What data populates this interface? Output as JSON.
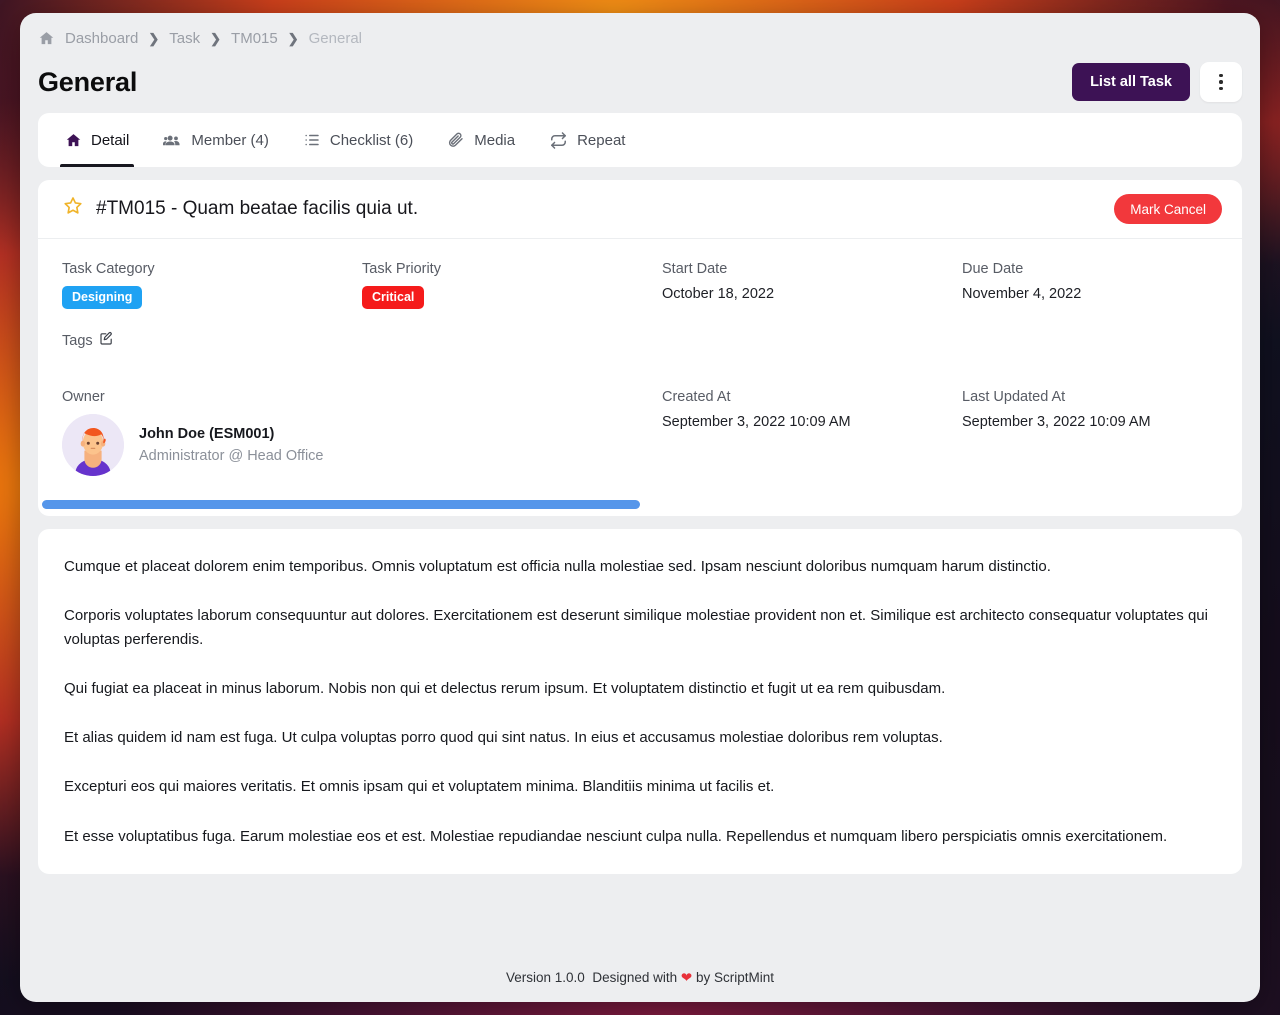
{
  "breadcrumb": {
    "home_icon": "home-icon",
    "items": [
      {
        "label": "Dashboard"
      },
      {
        "label": "Task"
      },
      {
        "label": "TM015"
      },
      {
        "label": "General"
      }
    ],
    "separator": "❯"
  },
  "header": {
    "title": "General",
    "primary_button": "List all Task",
    "kebab_icon": "more-vertical-icon",
    "primary_color": "#3d1255"
  },
  "tabs": [
    {
      "label": "Detail",
      "icon": "home-icon",
      "active": true
    },
    {
      "label": "Member (4)",
      "icon": "users-icon",
      "active": false
    },
    {
      "label": "Checklist (6)",
      "icon": "list-icon",
      "active": false
    },
    {
      "label": "Media",
      "icon": "paperclip-icon",
      "active": false
    },
    {
      "label": "Repeat",
      "icon": "repeat-icon",
      "active": false
    }
  ],
  "task": {
    "star_icon": "star-outline-icon",
    "title": "#TM015 - Quam beatae facilis quia ut.",
    "status_button": "Mark Cancel",
    "status_button_color": "#f2383c",
    "fields": {
      "category_label": "Task Category",
      "category_value": "Designing",
      "category_color": "#1fa2f3",
      "priority_label": "Task Priority",
      "priority_value": "Critical",
      "priority_color": "#f51b1b",
      "start_date_label": "Start Date",
      "start_date_value": "October 18, 2022",
      "due_date_label": "Due Date",
      "due_date_value": "November 4, 2022",
      "tags_label": "Tags",
      "tags_edit_icon": "edit-square-icon",
      "owner_label": "Owner",
      "created_at_label": "Created At",
      "created_at_value": "September 3, 2022 10:09 AM",
      "last_updated_label": "Last Updated At",
      "last_updated_value": "September 3, 2022 10:09 AM"
    },
    "owner": {
      "avatar_icon": "user-avatar",
      "name": "John Doe (ESM001)",
      "subtitle": "Administrator @ Head Office"
    }
  },
  "scrollbar": {
    "name": "horizontal-scrollbar",
    "thumb_percent": 50,
    "color": "#5596ea"
  },
  "description": {
    "paragraphs": [
      "Cumque et placeat dolorem enim temporibus. Omnis voluptatum est officia nulla molestiae sed. Ipsam nesciunt doloribus numquam harum distinctio.",
      "Corporis voluptates laborum consequuntur aut dolores. Exercitationem est deserunt similique molestiae provident non et. Similique est architecto consequatur voluptates qui voluptas perferendis.",
      "Qui fugiat ea placeat in minus laborum. Nobis non qui et delectus rerum ipsum. Et voluptatem distinctio et fugit ut ea rem quibusdam.",
      "Et alias quidem id nam est fuga. Ut culpa voluptas porro quod qui sint natus. In eius et accusamus molestiae doloribus rem voluptas.",
      "Excepturi eos qui maiores veritatis. Et omnis ipsam qui et voluptatem minima. Blanditiis minima ut facilis et.",
      "Et esse voluptatibus fuga. Earum molestiae eos et est. Molestiae repudiandae nesciunt culpa nulla. Repellendus et numquam libero perspiciatis omnis exercitationem."
    ]
  },
  "footer": {
    "version": "Version 1.0.0",
    "designed_prefix": "Designed with",
    "heart": "❤",
    "designed_suffix": "by ScriptMint"
  }
}
